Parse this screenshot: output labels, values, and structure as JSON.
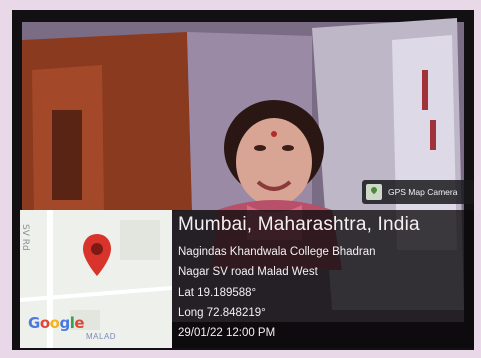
{
  "geotag": {
    "app_name": "GPS Map Camera",
    "map": {
      "road_label": "SV Rd",
      "logo": [
        "G",
        "o",
        "o",
        "g",
        "l",
        "e"
      ],
      "area_label": "MALAD"
    },
    "location_title": "Mumbai, Maharashtra, India",
    "address_line_1": "Nagindas Khandwala College Bhadran",
    "address_line_2": "Nagar SV road Malad West",
    "latitude": "Lat 19.189588°",
    "longitude": "Long 72.848219°",
    "timestamp": "29/01/22 12:00 PM"
  },
  "colors": {
    "frame": "#e9d8e8",
    "panel": "#0c0a0c",
    "pin": "#d9342b"
  },
  "icons": [
    "map-pin-icon",
    "app-badge-icon"
  ]
}
